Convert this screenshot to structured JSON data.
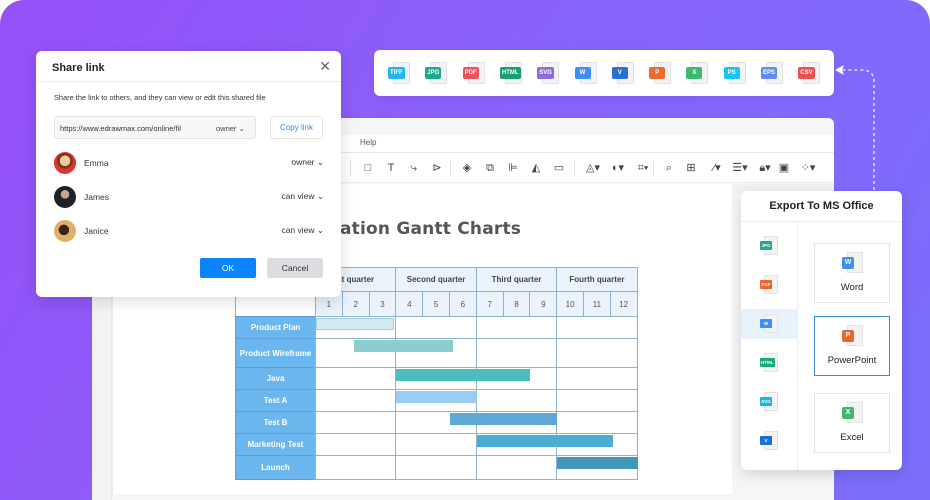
{
  "colors": {
    "accent_blue": "#0a84ff",
    "link_blue": "#2f8bf4",
    "task_blue": "#6bb6ee"
  },
  "editor": {
    "menu": {
      "help_label": "Help"
    },
    "toolbar": {
      "tools": [
        {
          "icon": "rectangle-icon",
          "glyph": "□"
        },
        {
          "icon": "text-icon",
          "glyph": "T"
        },
        {
          "icon": "connector-icon",
          "glyph": "⤷"
        },
        {
          "icon": "pointer-icon",
          "glyph": "⊳"
        },
        {
          "icon": "layers-icon",
          "glyph": "◈"
        },
        {
          "icon": "group-icon",
          "glyph": "⧉"
        },
        {
          "icon": "align-icon",
          "glyph": "⊫"
        },
        {
          "icon": "flip-icon",
          "glyph": "◭"
        },
        {
          "icon": "frame-icon",
          "glyph": "▭"
        },
        {
          "icon": "fill-icon",
          "glyph": "◬▾"
        },
        {
          "icon": "shape-style-icon",
          "glyph": "◐▾"
        },
        {
          "icon": "crop-icon",
          "glyph": "⌗▾"
        },
        {
          "icon": "zoom-icon",
          "glyph": "⌕"
        },
        {
          "icon": "find-replace-icon",
          "glyph": "⊞"
        },
        {
          "icon": "line-color-icon",
          "glyph": "∕▾"
        },
        {
          "icon": "line-style-icon",
          "glyph": "☰▾"
        },
        {
          "icon": "lock-icon",
          "glyph": "🔒︎▾"
        },
        {
          "icon": "fit-icon",
          "glyph": "▣"
        },
        {
          "icon": "more-icon",
          "glyph": "⁘▾"
        }
      ]
    }
  },
  "chart_data": {
    "type": "table",
    "title": "ation Gantt  Charts",
    "quarters": [
      "st quarter",
      "Second quarter",
      "Third quarter",
      "Fourth quarter"
    ],
    "months": [
      "1",
      "2",
      "3",
      "4",
      "5",
      "6",
      "7",
      "8",
      "9",
      "10",
      "11",
      "12"
    ],
    "tasks": [
      {
        "name": "Product Plan",
        "start": 1,
        "end": 3.9,
        "color": "#d3e9ee"
      },
      {
        "name": "Product Wireframe",
        "start": 2.4,
        "end": 6.1,
        "color": "#8ccdd0"
      },
      {
        "name": "Java",
        "start": 4,
        "end": 9,
        "color": "#4fbcbf"
      },
      {
        "name": "Test A",
        "start": 4,
        "end": 7,
        "color": "#9acdf4"
      },
      {
        "name": "Test B",
        "start": 6,
        "end": 10,
        "color": "#5ea8d8"
      },
      {
        "name": "Marketing Test",
        "start": 7,
        "end": 12.1,
        "color": "#4aadd6"
      },
      {
        "name": "Launch",
        "start": 10,
        "end": 13,
        "color": "#4099bb"
      }
    ]
  },
  "formats": [
    {
      "label": "TIFF",
      "color": "#1fb6f0",
      "icon": "tiff-file-icon"
    },
    {
      "label": "JPG",
      "color": "#21a98f",
      "icon": "jpg-file-icon"
    },
    {
      "label": "PDF",
      "color": "#f0505a",
      "icon": "pdf-file-icon"
    },
    {
      "label": "HTML",
      "color": "#1a9e72",
      "icon": "html-file-icon"
    },
    {
      "label": "SVG",
      "color": "#8f6be0",
      "icon": "svg-file-icon"
    },
    {
      "label": "W",
      "color": "#3d8ff5",
      "icon": "word-file-icon"
    },
    {
      "label": "V",
      "color": "#2a6fd6",
      "icon": "visio-file-icon"
    },
    {
      "label": "P",
      "color": "#ee6a2e",
      "icon": "powerpoint-file-icon"
    },
    {
      "label": "X",
      "color": "#3fb872",
      "icon": "excel-file-icon"
    },
    {
      "label": "PS",
      "color": "#18c2f5",
      "icon": "ps-file-icon"
    },
    {
      "label": "EPS",
      "color": "#5f8cf0",
      "icon": "eps-file-icon"
    },
    {
      "label": "CSV",
      "color": "#ea5050",
      "icon": "csv-file-icon"
    }
  ],
  "share": {
    "title": "Share link",
    "description": "Share the link to others, and they can view or edit this shared file",
    "link_value": "https://www.edrawmax.com/online/fil",
    "link_permission": "owner ⌄",
    "copy_label": "Copy link",
    "users": [
      {
        "name": "Emma",
        "permission": "owner  ⌄",
        "avatar_color": "#d58a3a"
      },
      {
        "name": "James",
        "permission": "can view  ⌄",
        "avatar_color": "#2f3a44"
      },
      {
        "name": "Janice",
        "permission": "can view  ⌄",
        "avatar_color": "#d6a65a"
      }
    ],
    "ok_label": "OK",
    "cancel_label": "Cancel"
  },
  "msoffice": {
    "title": "Export To MS Office",
    "side_items": [
      {
        "label": "JPG",
        "color": "#21a98f",
        "icon": "jpg-file-icon",
        "active": false
      },
      {
        "label": "PDF",
        "color": "#f06428",
        "icon": "pdf-file-icon",
        "active": false
      },
      {
        "label": "W",
        "color": "#3d8ff5",
        "icon": "word-file-icon",
        "active": true
      },
      {
        "label": "HTML",
        "color": "#1aab7c",
        "icon": "html-file-icon",
        "active": false
      },
      {
        "label": "SVG",
        "color": "#18b8d8",
        "icon": "svg-file-icon",
        "active": false
      },
      {
        "label": "V",
        "color": "#1a6fe0",
        "icon": "visio-file-icon",
        "active": false
      }
    ],
    "cards": [
      {
        "label": "Word",
        "tag": "W",
        "color": "#3d8ff5",
        "selected": false
      },
      {
        "label": "PowerPoint",
        "tag": "P",
        "color": "#f06428",
        "selected": true
      },
      {
        "label": "Excel",
        "tag": "X",
        "color": "#3fb872",
        "selected": false
      }
    ]
  }
}
